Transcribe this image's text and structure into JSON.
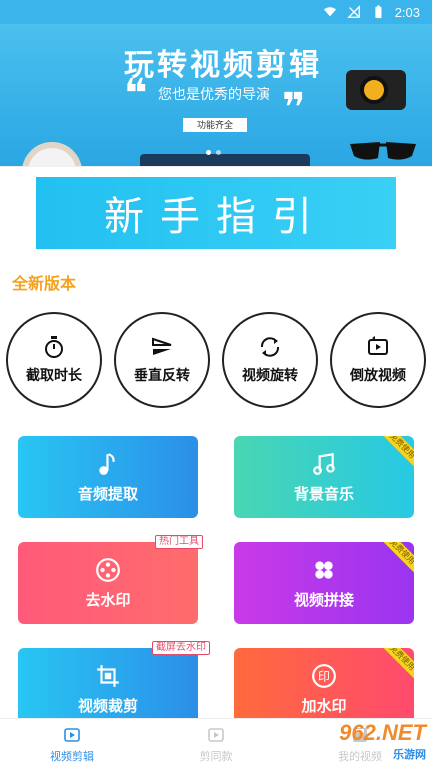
{
  "status_bar": {
    "time": "2:03"
  },
  "banner": {
    "title": "玩转视频剪辑",
    "slogan": "您也是优秀的导演",
    "tag": "功能齐全",
    "quote_open": "❝",
    "quote_close": "❞"
  },
  "guide": {
    "text": "新手指引"
  },
  "section": {
    "title": "全新版本"
  },
  "round_tools": [
    {
      "label": "截取时长",
      "icon": "stopwatch-icon"
    },
    {
      "label": "垂直反转",
      "icon": "flip-vertical-icon"
    },
    {
      "label": "视频旋转",
      "icon": "rotate-icon"
    },
    {
      "label": "倒放视频",
      "icon": "reverse-play-icon"
    }
  ],
  "cards": {
    "audio": {
      "label": "音频提取",
      "icon": "music-note-icon"
    },
    "bgm": {
      "label": "背景音乐",
      "icon": "music-notes-icon",
      "corner": "免费使用"
    },
    "watermark_remove": {
      "label": "去水印",
      "icon": "film-reel-icon",
      "badge": "热门工具"
    },
    "join": {
      "label": "视频拼接",
      "icon": "clover-icon",
      "corner": "免费使用"
    },
    "crop": {
      "label": "视频裁剪",
      "icon": "crop-icon",
      "badge": "截屏去水印"
    },
    "add_mark": {
      "label": "加水印",
      "icon": "stamp-icon",
      "corner": "免费使用"
    }
  },
  "bottom_nav": [
    {
      "label": "视频剪辑",
      "icon": "edit-video-icon",
      "active": true
    },
    {
      "label": "剪同款",
      "icon": "template-icon",
      "active": false
    },
    {
      "label": "我的视频",
      "icon": "save-icon",
      "active": false
    }
  ],
  "watermark": {
    "brand": "962.NET",
    "site": "乐游网"
  },
  "colors": {
    "accent": "#2d8ee6",
    "section_title": "#f5a21c",
    "banner": "#3ab4ea"
  }
}
